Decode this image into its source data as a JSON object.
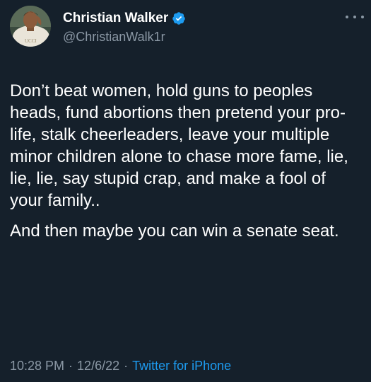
{
  "tweet": {
    "author": {
      "display_name": "Christian Walker",
      "handle": "@ChristianWalk1r",
      "verified": true,
      "avatar_icon": "profile-photo",
      "avatar_shirt_text": "UCCI"
    },
    "more_icon": "ellipsis-icon",
    "paragraphs": [
      "Don’t beat women, hold guns to peoples heads, fund abortions then pretend your pro-life, stalk cheerleaders, leave your multiple minor children alone to chase more fame, lie, lie, lie, say stupid crap, and make a fool of your family..",
      "And then maybe you can win a senate seat."
    ],
    "time": "10:28 PM",
    "date": "12/6/22",
    "source": "Twitter for iPhone",
    "separator": "·"
  },
  "colors": {
    "background": "#15202b",
    "text": "#ffffff",
    "secondary": "#8b98a5",
    "link": "#1d9bf0",
    "verified": "#1d9bf0"
  }
}
